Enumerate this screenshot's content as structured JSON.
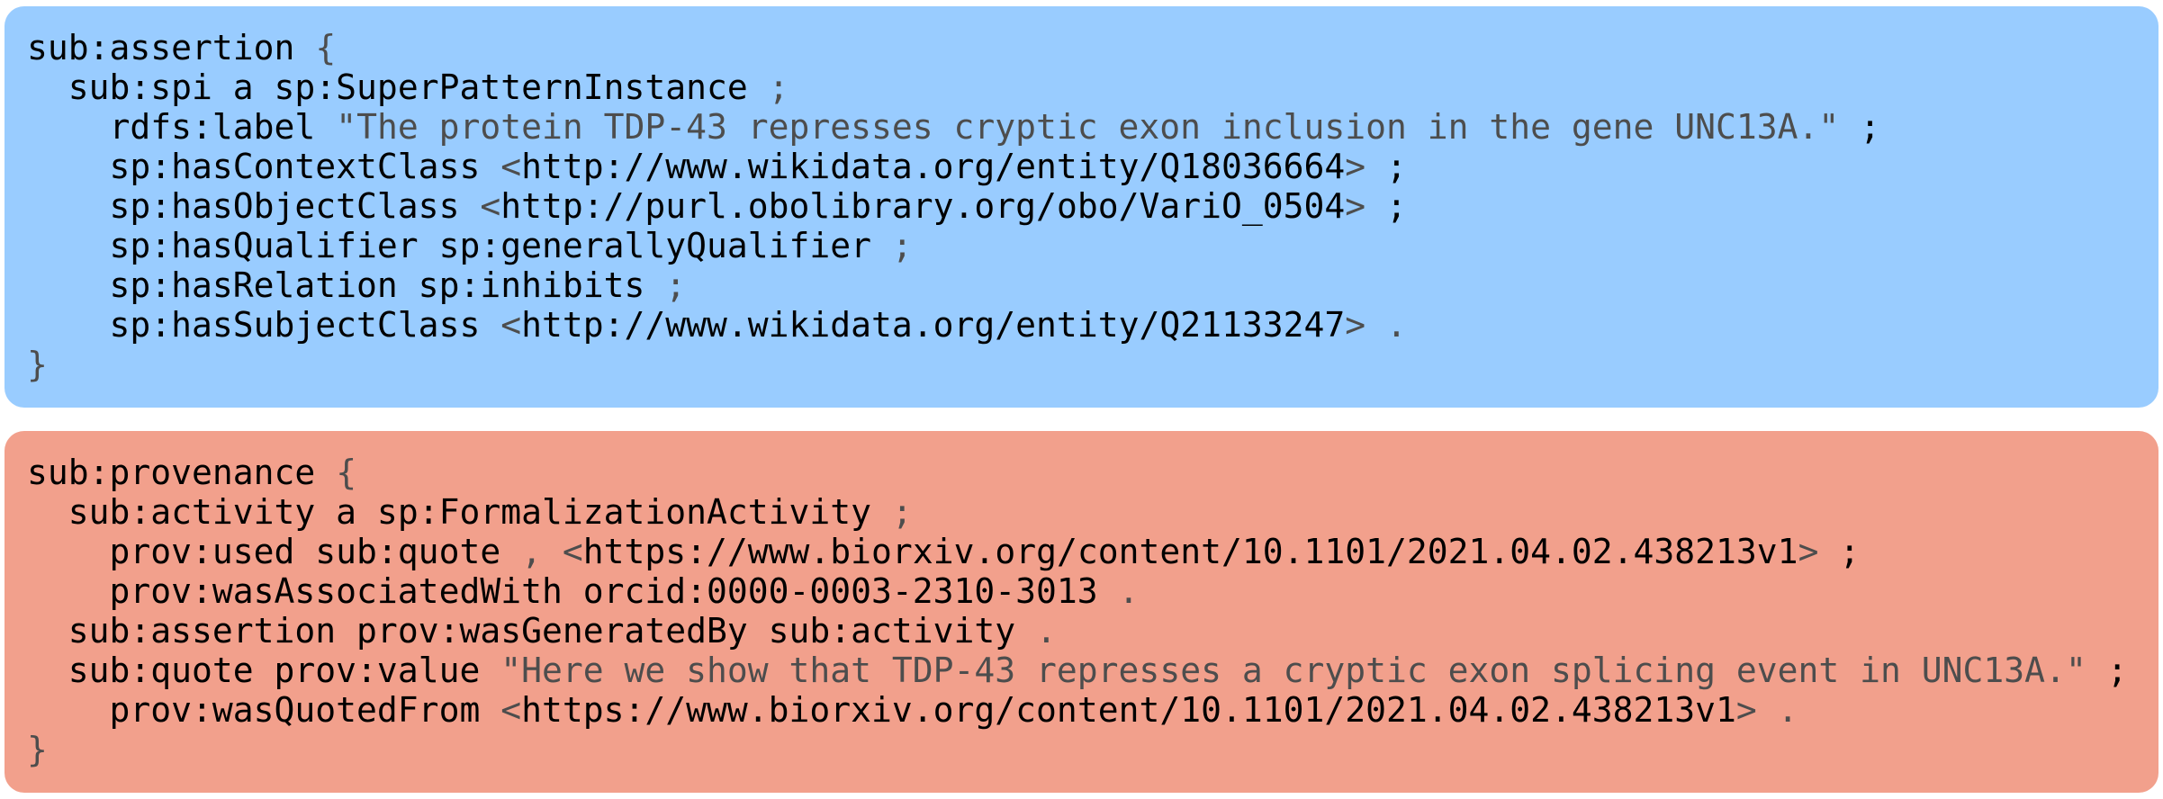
{
  "blocks": [
    {
      "id": "assertion",
      "color": "#99ccff",
      "lines": [
        {
          "indent": 0,
          "tokens": [
            {
              "t": "sub:assertion",
              "k": "term"
            },
            {
              "t": " "
            },
            {
              "t": "{",
              "k": "punct"
            }
          ]
        },
        {
          "indent": 1,
          "tokens": [
            {
              "t": "sub:spi a sp:SuperPatternInstance",
              "k": "term"
            },
            {
              "t": " "
            },
            {
              "t": ";",
              "k": "punct"
            }
          ]
        },
        {
          "indent": 2,
          "tokens": [
            {
              "t": "rdfs:label",
              "k": "term"
            },
            {
              "t": " "
            },
            {
              "t": "\"The protein TDP-43 represses cryptic exon inclusion in the gene UNC13A.\"",
              "k": "str"
            },
            {
              "t": " "
            },
            {
              "t": ";",
              "k": "term"
            }
          ]
        },
        {
          "indent": 2,
          "tokens": [
            {
              "t": "sp:hasContextClass",
              "k": "term"
            },
            {
              "t": " "
            },
            {
              "t": "<",
              "k": "punct"
            },
            {
              "t": "http://www.wikidata.org/entity/Q18036664",
              "k": "term"
            },
            {
              "t": ">",
              "k": "punct"
            },
            {
              "t": " "
            },
            {
              "t": ";",
              "k": "term"
            }
          ]
        },
        {
          "indent": 2,
          "tokens": [
            {
              "t": "sp:hasObjectClass",
              "k": "term"
            },
            {
              "t": " "
            },
            {
              "t": "<",
              "k": "punct"
            },
            {
              "t": "http://purl.obolibrary.org/obo/VariO_0504",
              "k": "term"
            },
            {
              "t": ">",
              "k": "punct"
            },
            {
              "t": " "
            },
            {
              "t": ";",
              "k": "term"
            }
          ]
        },
        {
          "indent": 2,
          "tokens": [
            {
              "t": "sp:hasQualifier sp:generallyQualifier",
              "k": "term"
            },
            {
              "t": " "
            },
            {
              "t": ";",
              "k": "punct"
            }
          ]
        },
        {
          "indent": 2,
          "tokens": [
            {
              "t": "sp:hasRelation sp:inhibits",
              "k": "term"
            },
            {
              "t": " "
            },
            {
              "t": ";",
              "k": "punct"
            }
          ]
        },
        {
          "indent": 2,
          "tokens": [
            {
              "t": "sp:hasSubjectClass",
              "k": "term"
            },
            {
              "t": " "
            },
            {
              "t": "<",
              "k": "punct"
            },
            {
              "t": "http://www.wikidata.org/entity/Q21133247",
              "k": "term"
            },
            {
              "t": ">",
              "k": "punct"
            },
            {
              "t": " "
            },
            {
              "t": ".",
              "k": "punct"
            }
          ]
        },
        {
          "indent": 0,
          "tokens": [
            {
              "t": "}",
              "k": "punct"
            }
          ]
        }
      ]
    },
    {
      "id": "provenance",
      "color": "#f2a08c",
      "lines": [
        {
          "indent": 0,
          "tokens": [
            {
              "t": "sub:provenance",
              "k": "term"
            },
            {
              "t": " "
            },
            {
              "t": "{",
              "k": "punct"
            }
          ]
        },
        {
          "indent": 1,
          "tokens": [
            {
              "t": "sub:activity a sp:FormalizationActivity",
              "k": "term"
            },
            {
              "t": " "
            },
            {
              "t": ";",
              "k": "punct"
            }
          ]
        },
        {
          "indent": 2,
          "tokens": [
            {
              "t": "prov:used sub:quote",
              "k": "term"
            },
            {
              "t": " "
            },
            {
              "t": ",",
              "k": "punct"
            },
            {
              "t": " "
            },
            {
              "t": "<",
              "k": "punct"
            },
            {
              "t": "https://www.biorxiv.org/content/10.1101/2021.04.02.438213v1",
              "k": "term"
            },
            {
              "t": ">",
              "k": "punct"
            },
            {
              "t": " "
            },
            {
              "t": ";",
              "k": "term"
            }
          ]
        },
        {
          "indent": 2,
          "tokens": [
            {
              "t": "prov:wasAssociatedWith orcid:0000-0003-2310-3013",
              "k": "term"
            },
            {
              "t": " "
            },
            {
              "t": ".",
              "k": "punct"
            }
          ]
        },
        {
          "indent": 1,
          "tokens": [
            {
              "t": "sub:assertion prov:wasGeneratedBy sub:activity",
              "k": "term"
            },
            {
              "t": " "
            },
            {
              "t": ".",
              "k": "punct"
            }
          ]
        },
        {
          "indent": 1,
          "tokens": [
            {
              "t": "sub:quote prov:value",
              "k": "term"
            },
            {
              "t": " "
            },
            {
              "t": "\"Here we show that TDP-43 represses a cryptic exon splicing event in UNC13A.\"",
              "k": "str"
            },
            {
              "t": " "
            },
            {
              "t": ";",
              "k": "term"
            }
          ]
        },
        {
          "indent": 2,
          "tokens": [
            {
              "t": "prov:wasQuotedFrom",
              "k": "term"
            },
            {
              "t": " "
            },
            {
              "t": "<",
              "k": "punct"
            },
            {
              "t": "https://www.biorxiv.org/content/10.1101/2021.04.02.438213v1",
              "k": "term"
            },
            {
              "t": ">",
              "k": "punct"
            },
            {
              "t": " "
            },
            {
              "t": ".",
              "k": "punct"
            }
          ]
        },
        {
          "indent": 0,
          "tokens": [
            {
              "t": "}",
              "k": "punct"
            }
          ]
        }
      ]
    }
  ]
}
